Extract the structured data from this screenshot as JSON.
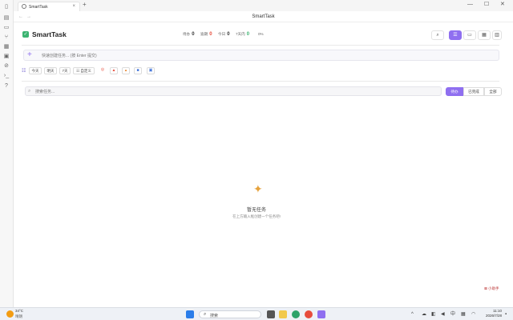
{
  "tab": {
    "label": "SmartTask",
    "close": "×",
    "new": "+"
  },
  "window": {
    "title": "SmartTask",
    "back": "←",
    "forward": "→",
    "min": "—",
    "max": "☐",
    "close": "✕"
  },
  "header": {
    "brand": "SmartTask",
    "stats": [
      {
        "label": "待办",
        "value": "0",
        "color": "#333333"
      },
      {
        "label": "逾期",
        "value": "0",
        "color": "#e74c3c"
      },
      {
        "label": "今日",
        "value": "0",
        "color": "#333333"
      },
      {
        "label": "7天内",
        "value": "0",
        "color": "#3cb371"
      }
    ],
    "percent": "0%"
  },
  "quick": {
    "placeholder": "快速创建任务... (按 Enter 提交)"
  },
  "filters": {
    "today": "今天",
    "tomorrow": "明天",
    "seven": "7天",
    "custom": "☷ 自定义"
  },
  "search": {
    "placeholder": "搜索任务..."
  },
  "segments": {
    "pending": "待办",
    "done": "已完成",
    "all": "全部"
  },
  "empty": {
    "title": "暂无任务",
    "subtitle": "在上方输入框创建一个任务吧!"
  },
  "badge": {
    "text": "⊠ 小助手"
  },
  "taskbar": {
    "temp": "34°C",
    "weather": "晴朗",
    "search": "搜索",
    "ime": "中",
    "time": "11:10",
    "date": "2026/7/28"
  },
  "colors": {
    "accent": "#8f6ff0",
    "success": "#3cb371",
    "danger": "#e74c3c"
  }
}
